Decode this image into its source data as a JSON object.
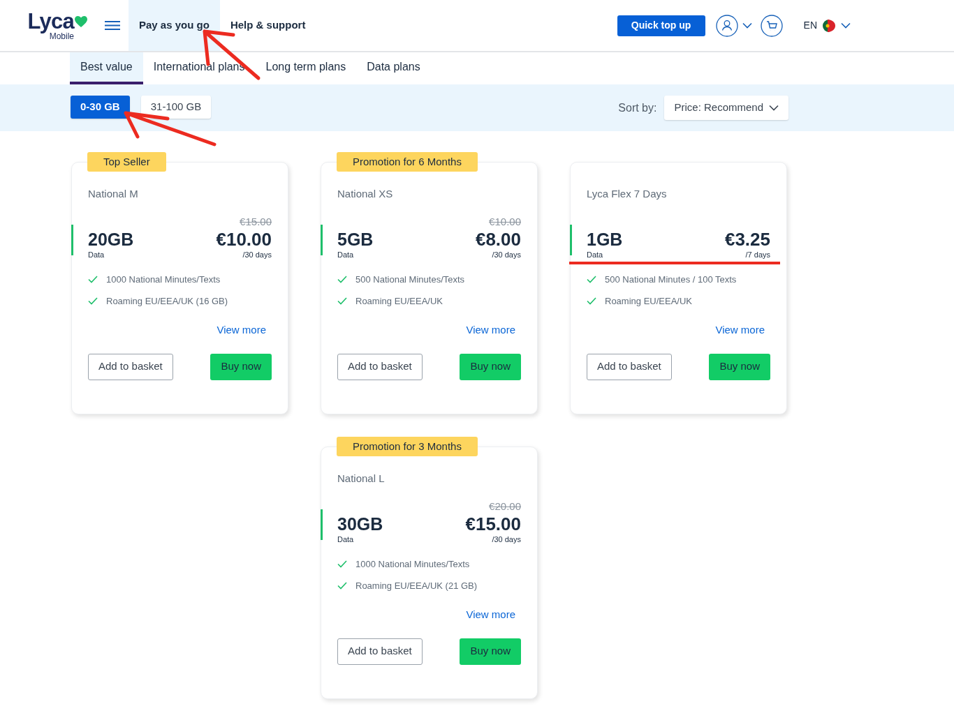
{
  "logo": {
    "wordmark": "Lyca",
    "subtitle": "Mobile"
  },
  "nav": [
    {
      "label": "Pay as you go",
      "selected": true
    },
    {
      "label": "Help & support",
      "selected": false
    }
  ],
  "quick_top_up": "Quick top up",
  "language": "EN",
  "tabs": [
    {
      "label": "Best value",
      "selected": true
    },
    {
      "label": "International plans",
      "selected": false
    },
    {
      "label": "Long term plans",
      "selected": false
    },
    {
      "label": "Data plans",
      "selected": false
    }
  ],
  "filters": [
    {
      "label": "0-30 GB",
      "selected": true
    },
    {
      "label": "31-100 GB",
      "selected": false
    }
  ],
  "sort": {
    "label": "Sort by:",
    "value": "Price: Recommend"
  },
  "plans": [
    {
      "badge": "Top Seller",
      "name": "National M",
      "old_price": "€15.00",
      "data": "20GB",
      "data_label": "Data",
      "price": "€10.00",
      "period": "/30 days",
      "features": [
        "1000 National Minutes/Texts",
        "Roaming EU/EEA/UK (16 GB)"
      ],
      "view_more": "View more",
      "add": "Add to basket",
      "buy": "Buy now"
    },
    {
      "badge": "Promotion for 6 Months",
      "name": "National XS",
      "old_price": "€10.00",
      "data": "5GB",
      "data_label": "Data",
      "price": "€8.00",
      "period": "/30 days",
      "features": [
        "500 National Minutes/Texts",
        "Roaming EU/EEA/UK"
      ],
      "view_more": "View more",
      "add": "Add to basket",
      "buy": "Buy now"
    },
    {
      "name": "Lyca Flex 7 Days",
      "data": "1GB",
      "data_label": "Data",
      "price": "€3.25",
      "period": "/7 days",
      "features": [
        "500 National Minutes / 100 Texts",
        "Roaming EU/EEA/UK"
      ],
      "view_more": "View more",
      "add": "Add to basket",
      "buy": "Buy now"
    },
    {
      "badge": "Promotion for 3 Months",
      "name": "National L",
      "old_price": "€20.00",
      "data": "30GB",
      "data_label": "Data",
      "price": "€15.00",
      "period": "/30 days",
      "features": [
        "1000 National Minutes/Texts",
        "Roaming EU/EEA/UK (21 GB)"
      ],
      "view_more": "View more",
      "add": "Add to basket",
      "buy": "Buy now"
    }
  ]
}
